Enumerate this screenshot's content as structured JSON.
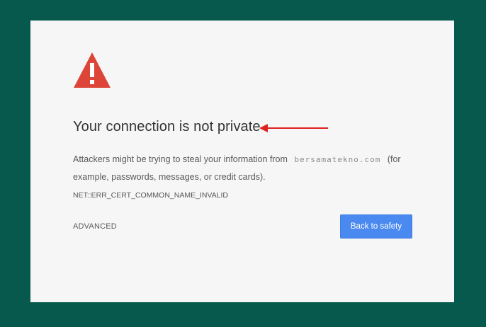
{
  "interstitial": {
    "title": "Your connection is not private",
    "desc_before": "Attackers might be trying to steal your information from",
    "hostname": "bersamatekno.com",
    "desc_after": "(for example, passwords, messages, or credit cards).",
    "error_code": "NET::ERR_CERT_COMMON_NAME_INVALID",
    "advanced_label": "ADVANCED",
    "back_label": "Back to safety"
  },
  "icons": {
    "warning": "warning-triangle-icon",
    "annotation": "red-arrow-left"
  },
  "colors": {
    "frame_bg": "#07594e",
    "panel_bg": "#f6f6f6",
    "warning_red": "#dc4537",
    "arrow_red": "#e02020",
    "button_blue": "#4a8af0"
  }
}
